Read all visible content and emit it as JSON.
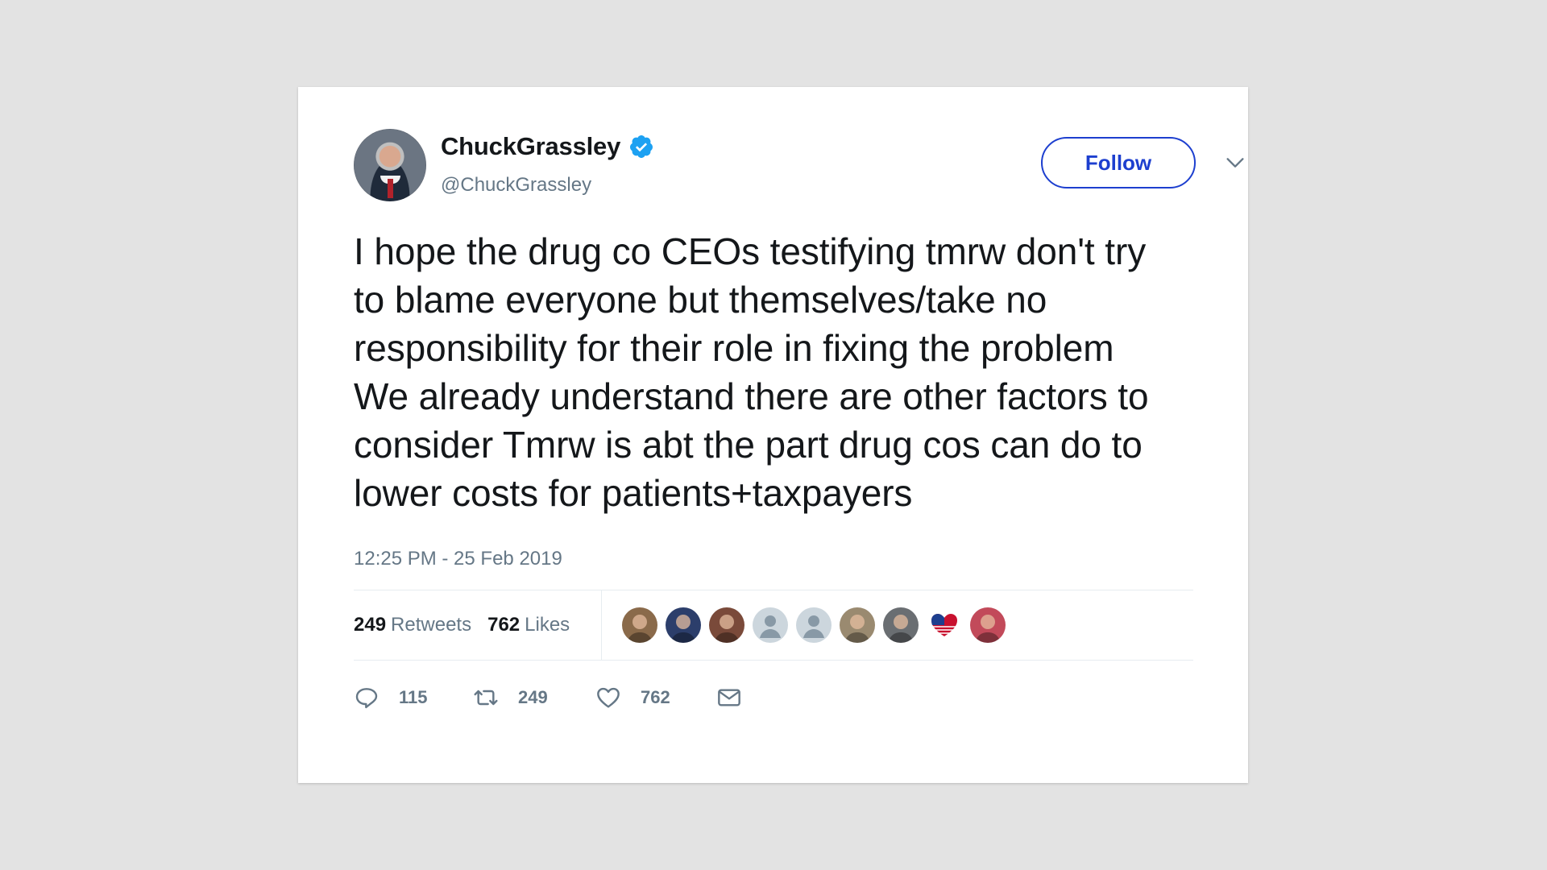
{
  "user": {
    "display_name": "ChuckGrassley",
    "handle": "@ChuckGrassley",
    "verified": true,
    "avatar_icon": "avatar"
  },
  "header": {
    "follow_label": "Follow",
    "menu_icon": "chevron-down-icon"
  },
  "tweet": {
    "text": "I hope the drug co CEOs testifying tmrw don't try to blame everyone but themselves/take no responsibility for their role in fixing the problem We already understand there are other factors to consider Tmrw is abt the part drug cos can do to lower costs for patients+taxpayers",
    "timestamp": "12:25 PM - 25 Feb 2019"
  },
  "stats": {
    "retweets_count": "249",
    "retweets_label": "Retweets",
    "likes_count": "762",
    "likes_label": "Likes"
  },
  "likers": [
    {
      "name": "liker-avatar-1",
      "color": "#8a6a4a"
    },
    {
      "name": "liker-avatar-2",
      "color": "#2c3e6b"
    },
    {
      "name": "liker-avatar-3",
      "color": "#7a4a3a"
    },
    {
      "name": "liker-avatar-4",
      "color": "#ccd6dd"
    },
    {
      "name": "liker-avatar-5",
      "color": "#ccd6dd"
    },
    {
      "name": "liker-avatar-6",
      "color": "#9a8a70"
    },
    {
      "name": "liker-avatar-7",
      "color": "#6a6e72"
    },
    {
      "name": "liker-avatar-8",
      "color": "#ffffff"
    },
    {
      "name": "liker-avatar-9",
      "color": "#c24a5a"
    }
  ],
  "actions": {
    "reply_count": "115",
    "retweet_count": "249",
    "like_count": "762"
  },
  "colors": {
    "background": "#e3e3e3",
    "card": "#ffffff",
    "accent": "#1d3fcf",
    "verified": "#1da1f2",
    "secondary_text": "#657786"
  }
}
